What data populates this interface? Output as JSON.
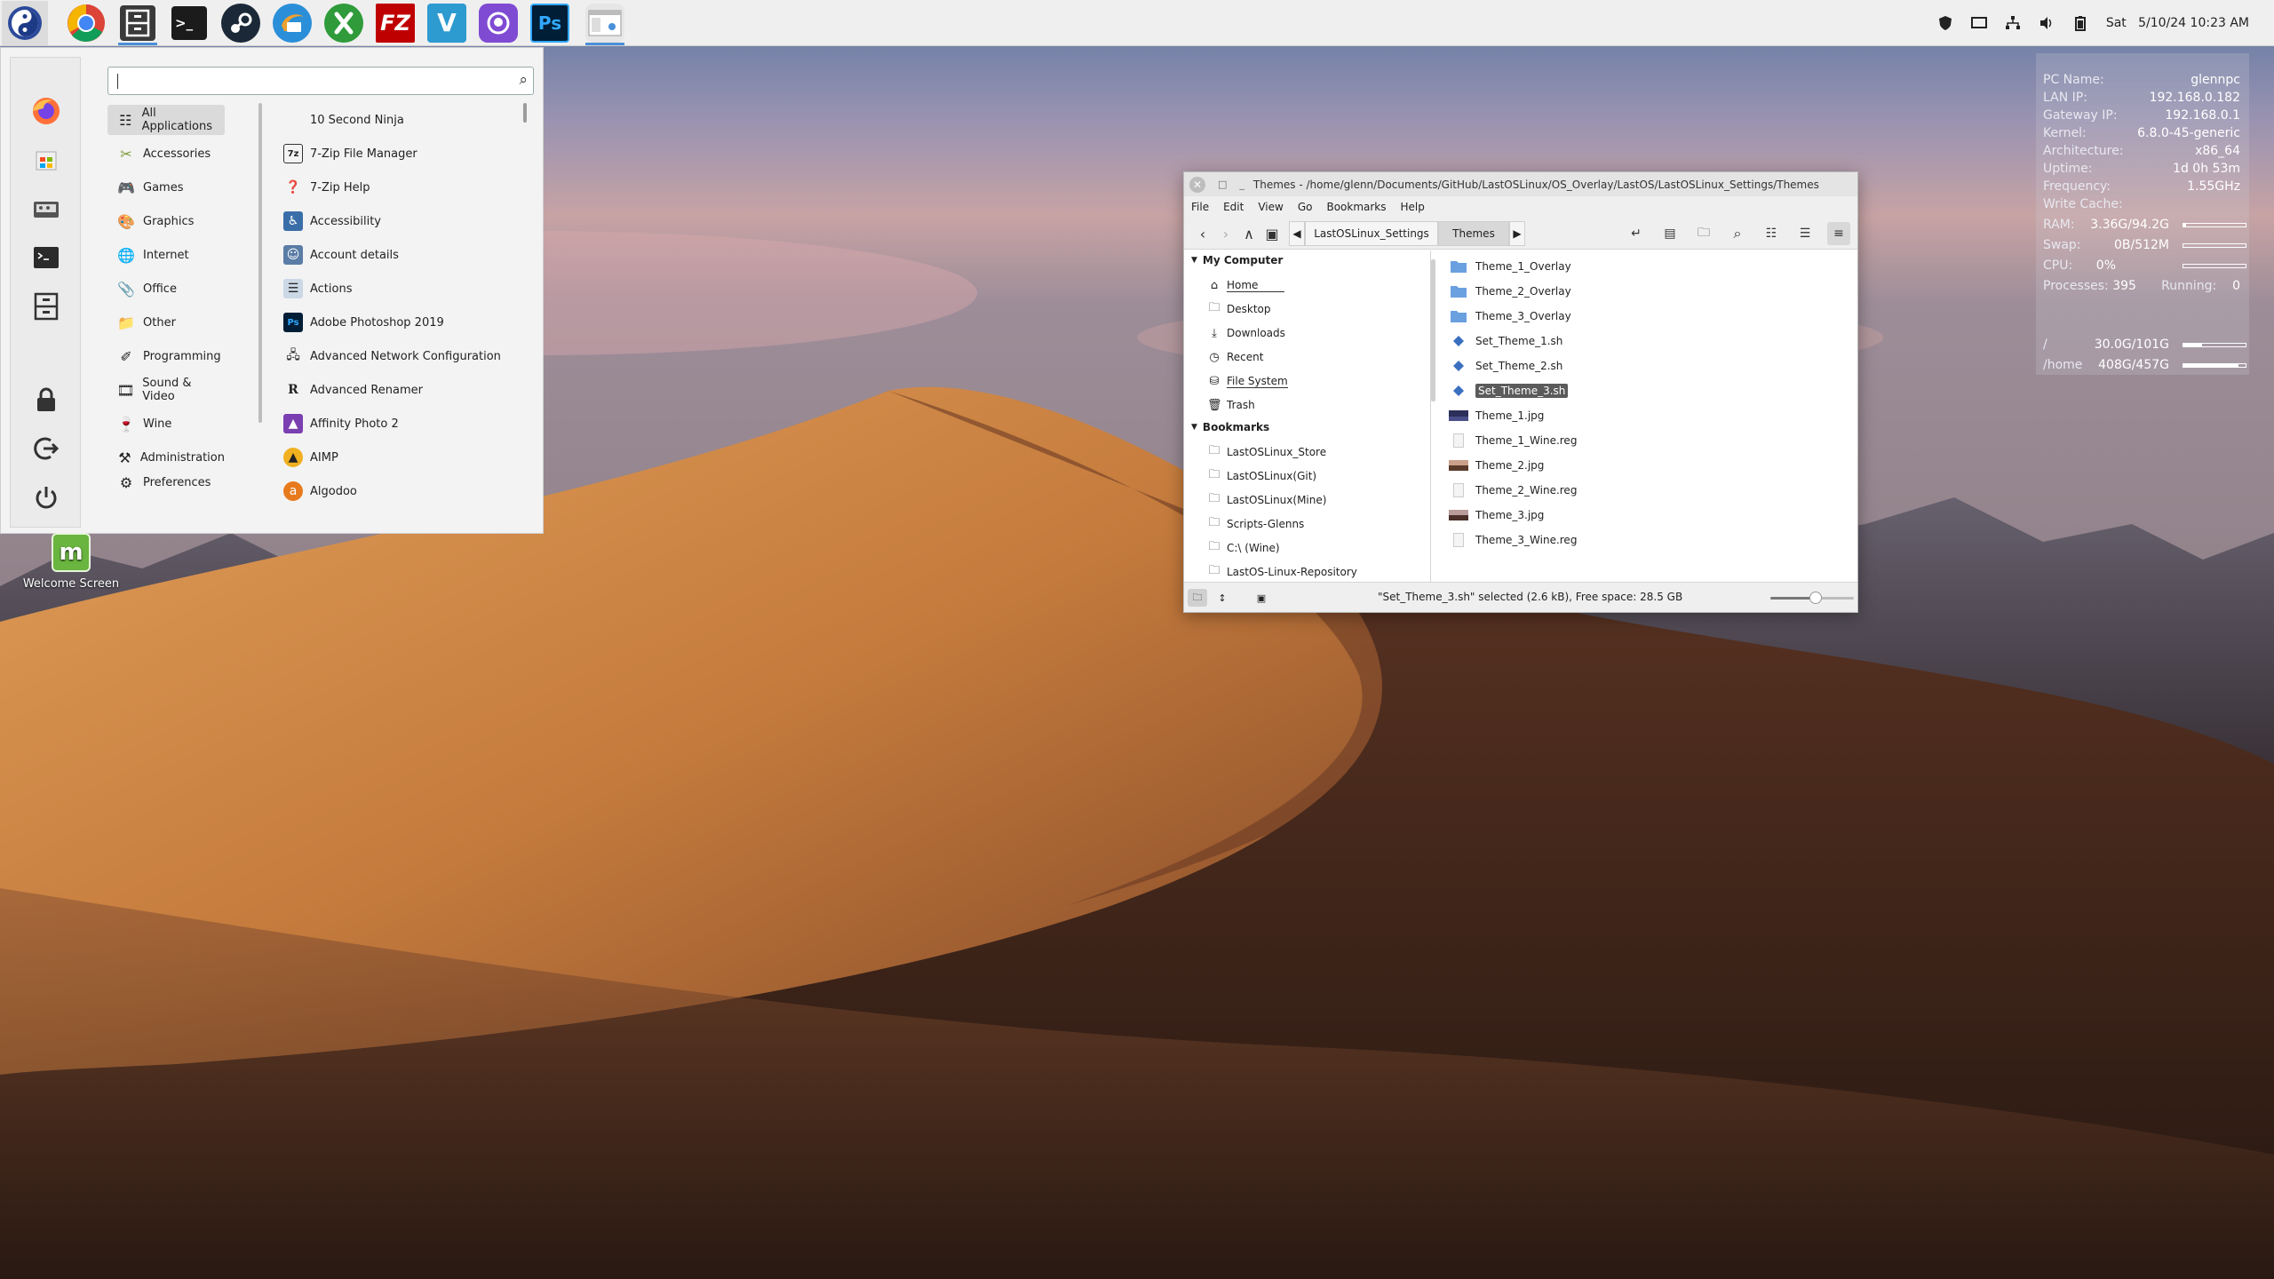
{
  "panel": {
    "launchers": [
      {
        "name": "menu-launcher",
        "label": ""
      },
      {
        "name": "chrome-launcher",
        "label": ""
      },
      {
        "name": "file-manager-launcher",
        "label": ""
      },
      {
        "name": "terminal-launcher",
        "label": ">_"
      },
      {
        "name": "steam-launcher",
        "label": ""
      },
      {
        "name": "thunderbird-launcher",
        "label": ""
      },
      {
        "name": "xbox-launcher",
        "label": ""
      },
      {
        "name": "filezilla-launcher",
        "label": "FZ"
      },
      {
        "name": "vs-launcher",
        "label": "V"
      },
      {
        "name": "github-launcher",
        "label": ""
      },
      {
        "name": "photoshop-launcher",
        "label": "Ps"
      }
    ],
    "clock": "Sat   5/10/24 10:23 AM"
  },
  "menu": {
    "search_placeholder": "",
    "categories": [
      "All Applications",
      "Accessories",
      "Games",
      "Graphics",
      "Internet",
      "Office",
      "Other",
      "Programming",
      "Sound & Video",
      "Wine",
      "Administration",
      "Preferences"
    ],
    "apps": [
      "10 Second Ninja",
      "7-Zip File Manager",
      "7-Zip Help",
      "Accessibility",
      "Account details",
      "Actions",
      "Adobe Photoshop 2019",
      "Advanced Network Configuration",
      "Advanced Renamer",
      "Affinity Photo 2",
      "AIMP",
      "Algodoo"
    ]
  },
  "desktop": {
    "welcome_label": "Welcome Screen"
  },
  "conky": {
    "rows": [
      {
        "label": "PC Name:",
        "value": "glennpc"
      },
      {
        "label": "LAN IP:",
        "value": "192.168.0.182"
      },
      {
        "label": "Gateway IP:",
        "value": "192.168.0.1"
      },
      {
        "label": "Kernel:",
        "value": "6.8.0-45-generic"
      },
      {
        "label": "Architecture:",
        "value": "x86_64"
      },
      {
        "label": "Uptime:",
        "value": "1d 0h 53m"
      },
      {
        "label": "Frequency:",
        "value": "1.55GHz"
      },
      {
        "label": "Write Cache:",
        "value": ""
      }
    ],
    "ram": {
      "label": "RAM:",
      "value": "3.36G/94.2G",
      "fraction": 0.04
    },
    "swap": {
      "label": "Swap:",
      "value": "0B/512M",
      "fraction": 0.0
    },
    "cpu": {
      "label": "CPU:",
      "value": "0%",
      "fraction": 0.0
    },
    "processes": {
      "label": "Processes:",
      "value": "395",
      "running_label": "Running:",
      "running_value": "0"
    },
    "root": {
      "label": "/",
      "value": "30.0G/101G",
      "fraction": 0.3
    },
    "home": {
      "label": "/home",
      "value": "408G/457G",
      "fraction": 0.89
    }
  },
  "fm": {
    "title": "Themes - /home/glenn/Documents/GitHub/LastOSLinux/OS_Overlay/LastOS/LastOSLinux_Settings/Themes",
    "menus": [
      "File",
      "Edit",
      "View",
      "Go",
      "Bookmarks",
      "Help"
    ],
    "breadcrumbs": [
      "LastOSLinux_Settings",
      "Themes"
    ],
    "sidebar": {
      "my_computer": "My Computer",
      "places": [
        "Home",
        "Desktop",
        "Downloads",
        "Recent",
        "File System",
        "Trash"
      ],
      "bookmarks_header": "Bookmarks",
      "bookmarks": [
        "LastOSLinux_Store",
        "LastOSLinux(Git)",
        "LastOSLinux(Mine)",
        "Scripts-Glenns",
        "C:\\ (Wine)",
        "LastOS-Linux-Repository"
      ]
    },
    "files": [
      {
        "name": "Theme_1_Overlay",
        "type": "folder"
      },
      {
        "name": "Theme_2_Overlay",
        "type": "folder"
      },
      {
        "name": "Theme_3_Overlay",
        "type": "folder"
      },
      {
        "name": "Set_Theme_1.sh",
        "type": "script"
      },
      {
        "name": "Set_Theme_2.sh",
        "type": "script"
      },
      {
        "name": "Set_Theme_3.sh",
        "type": "script",
        "selected": true
      },
      {
        "name": "Theme_1.jpg",
        "type": "image"
      },
      {
        "name": "Theme_1_Wine.reg",
        "type": "text"
      },
      {
        "name": "Theme_2.jpg",
        "type": "image"
      },
      {
        "name": "Theme_2_Wine.reg",
        "type": "text"
      },
      {
        "name": "Theme_3.jpg",
        "type": "image"
      },
      {
        "name": "Theme_3_Wine.reg",
        "type": "text"
      }
    ],
    "status": "\"Set_Theme_3.sh\" selected (2.6 kB), Free space: 28.5 GB",
    "zoom_fraction": 0.5
  },
  "colors": {
    "accent": "#4a90d9",
    "selection": "#5b5b5b",
    "menu_bg": "#f3f3f3",
    "folder": "#6aa0e0"
  }
}
